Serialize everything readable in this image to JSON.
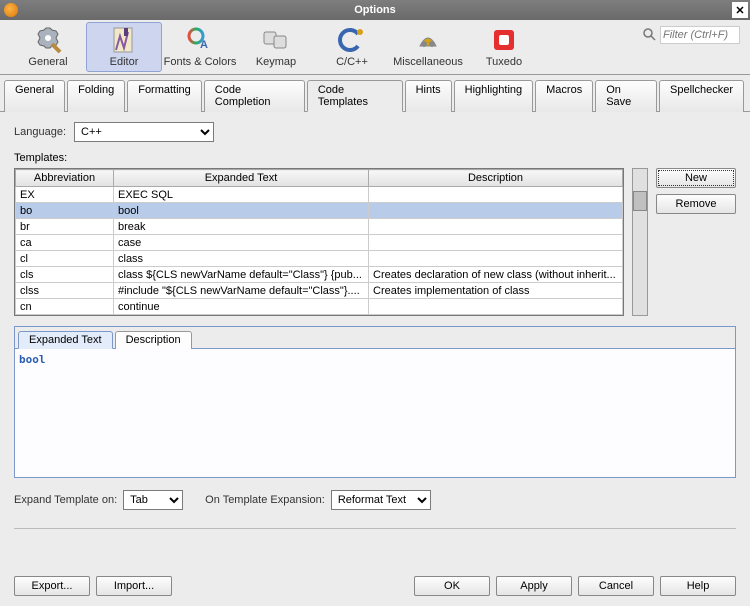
{
  "window": {
    "title": "Options"
  },
  "search": {
    "placeholder": "Filter (Ctrl+F)"
  },
  "categories": [
    {
      "id": "general",
      "label": "General"
    },
    {
      "id": "editor",
      "label": "Editor",
      "selected": true
    },
    {
      "id": "fonts",
      "label": "Fonts & Colors"
    },
    {
      "id": "keymap",
      "label": "Keymap"
    },
    {
      "id": "ccpp",
      "label": "C/C++"
    },
    {
      "id": "misc",
      "label": "Miscellaneous"
    },
    {
      "id": "tuxedo",
      "label": "Tuxedo"
    }
  ],
  "subtabs": [
    {
      "label": "General"
    },
    {
      "label": "Folding"
    },
    {
      "label": "Formatting"
    },
    {
      "label": "Code Completion"
    },
    {
      "label": "Code Templates",
      "active": true
    },
    {
      "label": "Hints"
    },
    {
      "label": "Highlighting"
    },
    {
      "label": "Macros"
    },
    {
      "label": "On Save"
    },
    {
      "label": "Spellchecker"
    }
  ],
  "language": {
    "label": "Language:",
    "value": "C++"
  },
  "templates_label": "Templates:",
  "table": {
    "headers": {
      "abbrev": "Abbreviation",
      "expanded": "Expanded Text",
      "desc": "Description"
    },
    "rows": [
      {
        "abbrev": "EX",
        "expanded": "EXEC SQL",
        "desc": ""
      },
      {
        "abbrev": "bo",
        "expanded": "bool",
        "desc": "",
        "selected": true
      },
      {
        "abbrev": "br",
        "expanded": "break",
        "desc": ""
      },
      {
        "abbrev": "ca",
        "expanded": "case",
        "desc": ""
      },
      {
        "abbrev": "cl",
        "expanded": "class",
        "desc": ""
      },
      {
        "abbrev": "cls",
        "expanded": "class ${CLS newVarName default=\"Class\"} {pub...",
        "desc": "Creates declaration of new class (without inherit..."
      },
      {
        "abbrev": "clss",
        "expanded": "#include \"${CLS newVarName default=\"Class\"}....",
        "desc": "Creates implementation of class"
      },
      {
        "abbrev": "cn",
        "expanded": "continue",
        "desc": ""
      }
    ]
  },
  "buttons": {
    "new": "New",
    "remove": "Remove"
  },
  "detail": {
    "tabs": [
      {
        "label": "Expanded Text",
        "active": true
      },
      {
        "label": "Description"
      }
    ],
    "content": "bool"
  },
  "expand_on": {
    "label": "Expand Template on:",
    "value": "Tab"
  },
  "on_expansion": {
    "label": "On Template Expansion:",
    "value": "Reformat Text"
  },
  "footer": {
    "export": "Export...",
    "import": "Import...",
    "ok": "OK",
    "apply": "Apply",
    "cancel": "Cancel",
    "help": "Help"
  }
}
